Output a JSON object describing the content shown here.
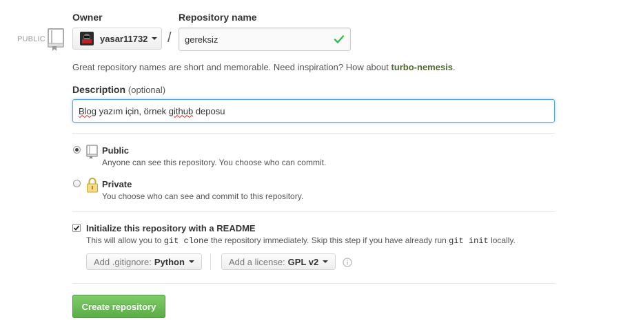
{
  "owner": {
    "label": "Owner",
    "username": "yasar11732"
  },
  "repository": {
    "label": "Repository name",
    "value": "gereksiz",
    "status_icon": "check-icon"
  },
  "visibility_badge": "PUBLIC",
  "hint": {
    "text": "Great repository names are short and memorable. Need inspiration? How about ",
    "suggestion": "turbo-nemesis",
    "suffix": "."
  },
  "description": {
    "label": "Description",
    "optional": "(optional)",
    "word1": "Blog",
    "mid": " yazım için, örnek ",
    "word2": "github",
    "end": " deposu"
  },
  "visibility": {
    "public": {
      "title": "Public",
      "desc": "Anyone can see this repository. You choose who can commit.",
      "selected": true,
      "icon": "repo-icon"
    },
    "private": {
      "title": "Private",
      "desc": "You choose who can see and commit to this repository.",
      "selected": false,
      "icon": "lock-icon"
    }
  },
  "readme": {
    "checked": true,
    "title": "Initialize this repository with a README",
    "desc_1": "This will allow you to ",
    "code_1": "git clone",
    "desc_2": " the repository immediately. Skip this step if you have already run ",
    "code_2": "git init",
    "desc_3": " locally."
  },
  "gitignore": {
    "prefix": "Add .gitignore:",
    "value": "Python"
  },
  "license": {
    "prefix": "Add a license:",
    "value": "GPL v2"
  },
  "submit_label": "Create repository",
  "colors": {
    "accent_green": "#5aad46",
    "check_green": "#2cbe4e",
    "focus_blue": "#51a7e8",
    "suggestion_green": "#4d6b2e"
  }
}
